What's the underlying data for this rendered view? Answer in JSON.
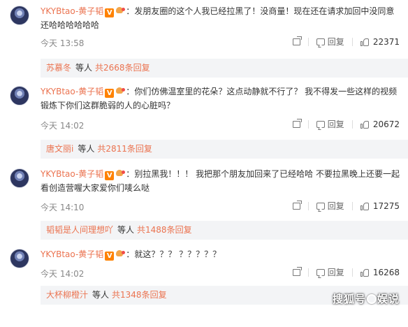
{
  "comments": [
    {
      "author": "YKYBtao-黄子韬",
      "verified_badge": "V",
      "separator": "：",
      "text_line1": "发朋友圈的这个人我已经拉黑了！没商量！现在还在请求加回中没同意",
      "text_line2": "还哈哈哈哈哈哈",
      "time": "今天 13:58",
      "reply_label": "回复",
      "likes": "22371",
      "reply_preview": {
        "user": "苏慕冬",
        "etc": "等人",
        "total": "共2668条回复"
      }
    },
    {
      "author": "YKYBtao-黄子韬",
      "verified_badge": "V",
      "separator": "：",
      "text_line1": "你们仿佛温室里的花朵？这点动静就不行了？ 我不得发一些这样的视频",
      "text_line2": "锻炼下你们这群脆弱的人的心脏吗？",
      "time": "今天 14:02",
      "reply_label": "回复",
      "likes": "20672",
      "reply_preview": {
        "user": "唐文丽i",
        "etc": "等人",
        "total": "共2811条回复"
      }
    },
    {
      "author": "YKYBtao-黄子韬",
      "verified_badge": "V",
      "separator": "：",
      "text_line1": "别拉黑我！！！ 我把那个朋友加回来了已经哈哈 不要拉黑晚上还要一起",
      "text_line2": "看创造营喔大家爱你们唛么哒",
      "time": "今天 14:10",
      "reply_label": "回复",
      "likes": "17275",
      "reply_preview": {
        "user": "韬韬是人间理想吖",
        "etc": "等人",
        "total": "共1488条回复"
      }
    },
    {
      "author": "YKYBtao-黄子韬",
      "verified_badge": "V",
      "separator": "：",
      "text_line1": "就这？？？ ？？？？？",
      "text_line2": "",
      "time": "今天 14:02",
      "reply_label": "回复",
      "likes": "16268",
      "reply_preview": {
        "user": "大杯柳橙汁",
        "etc": "等人",
        "total": "共1348条回复"
      }
    }
  ],
  "watermark": {
    "part1": "搜狐号",
    "part2": "娱",
    "part3": "说"
  },
  "icons": {
    "share": "share-icon",
    "comment": "comment-icon",
    "like": "thumbs-up-icon",
    "fan": "fan-badge-icon"
  },
  "colors": {
    "author": "#eb7350",
    "reply_bg": "#f3f4f6",
    "vip": "#ff8200"
  }
}
